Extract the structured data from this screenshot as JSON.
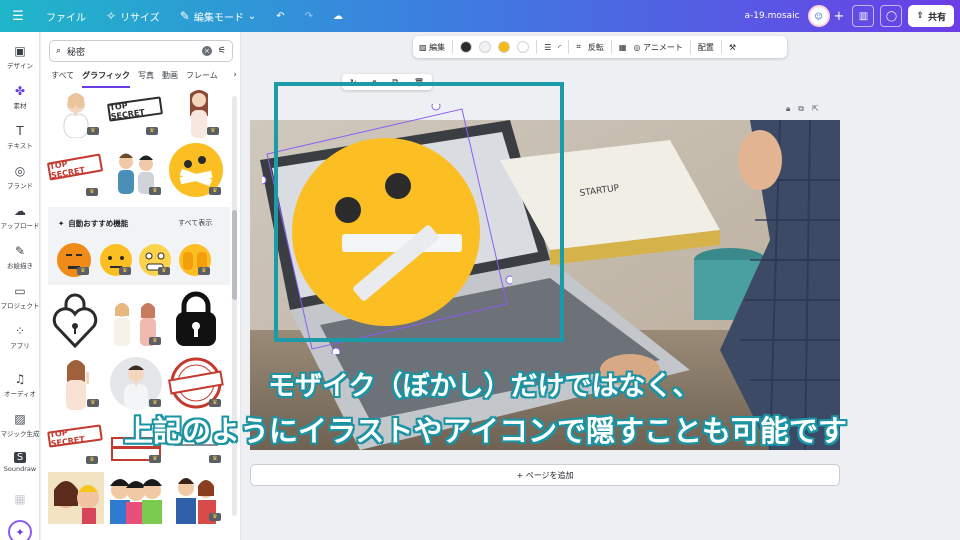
{
  "topbar": {
    "file_label": "ファイル",
    "resize_label": "リサイズ",
    "edit_mode_label": "編集モード",
    "doc_name": "a-19.mosaic",
    "share_label": "共有"
  },
  "rail": {
    "items": [
      {
        "label": "デザイン",
        "icon": "layout-icon"
      },
      {
        "label": "素材",
        "icon": "elements-icon"
      },
      {
        "label": "テキスト",
        "icon": "text-icon"
      },
      {
        "label": "ブランド",
        "icon": "brand-icon"
      },
      {
        "label": "アップロード",
        "icon": "upload-icon"
      },
      {
        "label": "お絵描き",
        "icon": "draw-icon"
      },
      {
        "label": "プロジェクト",
        "icon": "folder-icon"
      },
      {
        "label": "アプリ",
        "icon": "apps-icon"
      },
      {
        "label": "オーディオ",
        "icon": "audio-icon"
      },
      {
        "label": "マジック生成",
        "icon": "magic-media-icon"
      },
      {
        "label": "Soundraw",
        "icon": "soundraw-icon"
      }
    ]
  },
  "panel": {
    "search_value": "秘密",
    "tabs": [
      "すべて",
      "グラフィック",
      "写真",
      "動画",
      "フレーム"
    ],
    "active_tab": "グラフィック",
    "recommend_title": "自動おすすめ機能",
    "recommend_all": "すべて表示",
    "stamps": {
      "top_secret": "TOP SECRET",
      "confidential": "CONFIDENTIAL"
    }
  },
  "toolbar": {
    "edit": "編集",
    "flip": "反転",
    "animate": "アニメート",
    "position": "配置",
    "colors": [
      "#2b2b2b",
      "#f1f2f4",
      "#f7b917",
      "#ffffff"
    ]
  },
  "canvas": {
    "add_page": "+ ページを追加",
    "caption_line1": "モザイク（ぼかし）だけではなく、",
    "caption_line2": "上記のようにイラストやアイコンで隠すことも可能です"
  },
  "colors": {
    "accent": "#6a3de8",
    "teal": "#1d9aa8",
    "emoji_yellow": "#fbbf24"
  }
}
